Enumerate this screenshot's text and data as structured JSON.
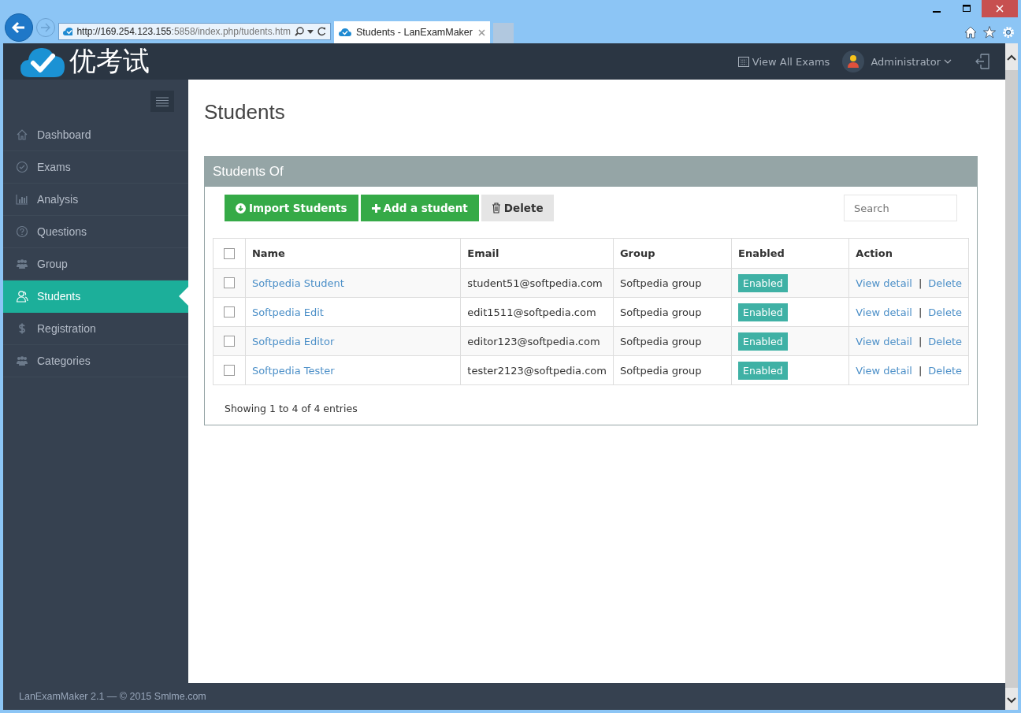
{
  "browser": {
    "address": {
      "host": "http://169.254.123.155",
      "rest": ":5858/index.php/tudents.htm"
    },
    "tab": {
      "title": "Students - LanExamMaker"
    }
  },
  "header": {
    "logo_text": "优考试",
    "view_all": "View All Exams",
    "user": "Administrator"
  },
  "sidebar": {
    "items": [
      {
        "label": "Dashboard",
        "selected": false
      },
      {
        "label": "Exams",
        "selected": false
      },
      {
        "label": "Analysis",
        "selected": false
      },
      {
        "label": "Questions",
        "selected": false
      },
      {
        "label": "Group",
        "selected": false
      },
      {
        "label": "Students",
        "selected": true
      },
      {
        "label": "Registration",
        "selected": false
      },
      {
        "label": "Categories",
        "selected": false
      }
    ]
  },
  "page": {
    "title": "Students",
    "panel_title": "Students Of",
    "buttons": [
      "Import Students",
      "Add a student",
      "Delete"
    ],
    "search": {
      "placeholder": "Search"
    }
  },
  "table": {
    "columns": [
      "Name",
      "Email",
      "Group",
      "Enabled",
      "Action"
    ],
    "header_checked": false,
    "rows": [
      {
        "checked": false,
        "name": "Softpedia Student",
        "email": "student51@softpedia.com",
        "group": "Softpedia group",
        "status": "Enabled",
        "view": "View detail",
        "separator": "|",
        "delete": "Delete"
      },
      {
        "checked": false,
        "name": "Softpedia Edit",
        "email": "edit1511@softpedia.com",
        "group": "Softpedia group",
        "status": "Enabled",
        "view": "View detail",
        "separator": "|",
        "delete": "Delete"
      },
      {
        "checked": false,
        "name": "Softpedia Editor",
        "email": "editor123@softpedia.com",
        "group": "Softpedia group",
        "status": "Enabled",
        "view": "View detail",
        "separator": "|",
        "delete": "Delete"
      },
      {
        "checked": false,
        "name": "Softpedia Tester",
        "email": "tester2123@softpedia.com",
        "group": "Softpedia group",
        "status": "Enabled",
        "view": "View detail",
        "separator": "|",
        "delete": "Delete"
      }
    ],
    "info": "Showing 1 to 4 of 4 entries"
  },
  "footer": {
    "text": "LanExamMaker 2.1 — © 2015 Smlme.com"
  }
}
